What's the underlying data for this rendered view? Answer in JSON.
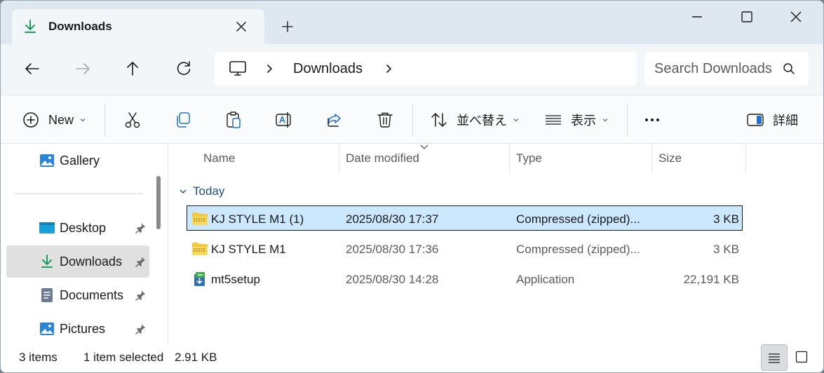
{
  "window": {
    "tab_title": "Downloads",
    "tab_icon": "download-arrow-icon",
    "controls": [
      "minimize-icon",
      "maximize-icon",
      "close-icon"
    ]
  },
  "address": {
    "root_icon": "this-pc-icon",
    "crumbs": [
      "Downloads"
    ],
    "search_placeholder": "Search Downloads"
  },
  "toolbar": {
    "new_label": "New",
    "sort_label": "並べ替え",
    "view_label": "表示",
    "details_label": "詳細",
    "icons": [
      "cut-icon",
      "copy-icon",
      "paste-icon",
      "rename-icon",
      "share-icon",
      "delete-icon",
      "more-icon"
    ]
  },
  "sidebar": {
    "items": [
      {
        "label": "Gallery",
        "icon": "gallery-icon",
        "pinned": false,
        "selected": false
      },
      {
        "label": "Desktop",
        "icon": "desktop-icon",
        "pinned": true,
        "selected": false
      },
      {
        "label": "Downloads",
        "icon": "download-arrow-icon",
        "pinned": true,
        "selected": true
      },
      {
        "label": "Documents",
        "icon": "documents-icon",
        "pinned": true,
        "selected": false
      },
      {
        "label": "Pictures",
        "icon": "pictures-icon",
        "pinned": true,
        "selected": false
      }
    ]
  },
  "files": {
    "columns": [
      "Name",
      "Date modified",
      "Type",
      "Size"
    ],
    "sort_column": "Date modified",
    "group_label": "Today",
    "rows": [
      {
        "name": "KJ STYLE M1 (1)",
        "date": "2025/08/30 17:37",
        "type": "Compressed (zipped)...",
        "size": "3 KB",
        "icon": "zip-folder-icon",
        "selected": true
      },
      {
        "name": "KJ STYLE M1",
        "date": "2025/08/30 17:36",
        "type": "Compressed (zipped)...",
        "size": "3 KB",
        "icon": "zip-folder-icon",
        "selected": false
      },
      {
        "name": "mt5setup",
        "date": "2025/08/30 14:28",
        "type": "Application",
        "size": "22,191 KB",
        "icon": "installer-icon",
        "selected": false
      }
    ]
  },
  "status": {
    "item_count": "3 items",
    "selection": "1 item selected",
    "selection_size": "2.91 KB"
  },
  "colors": {
    "accent": "#1e9e5e",
    "selection": "#cce8ff",
    "titlebar": "#dfe8f1"
  }
}
